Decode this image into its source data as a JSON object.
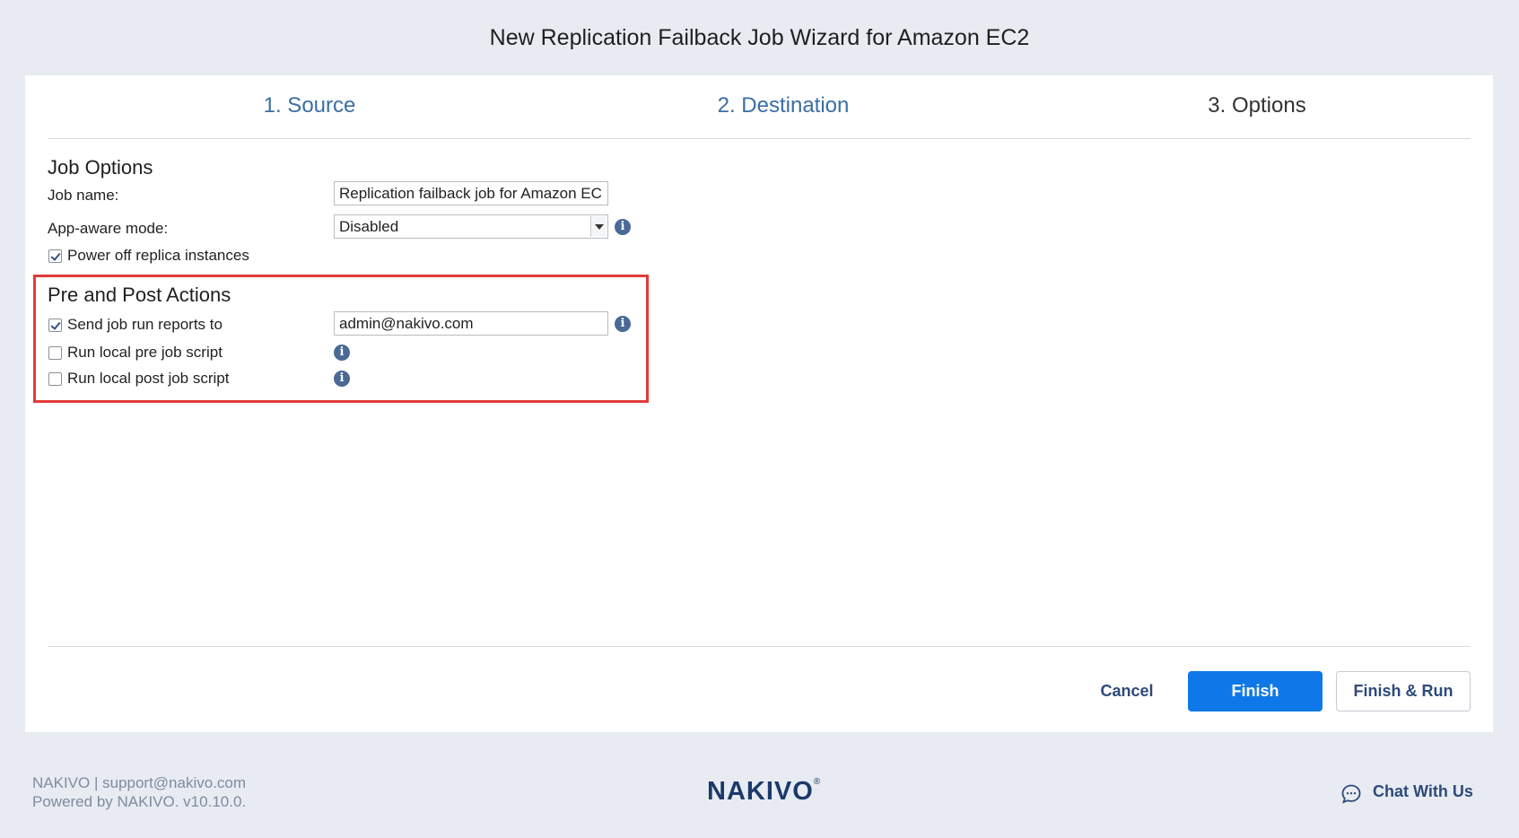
{
  "window": {
    "title": "New Replication Failback Job Wizard for Amazon EC2"
  },
  "steps": [
    {
      "label": "1. Source",
      "state": "done"
    },
    {
      "label": "2. Destination",
      "state": "done"
    },
    {
      "label": "3. Options",
      "state": "active"
    }
  ],
  "job_options": {
    "title": "Job Options",
    "job_name_label": "Job name:",
    "job_name_value": "Replication failback job for Amazon EC",
    "app_aware_label": "App-aware mode:",
    "app_aware_value": "Disabled",
    "power_off_label": "Power off replica instances",
    "power_off_checked": true
  },
  "pre_post": {
    "title": "Pre and Post Actions",
    "send_reports_label": "Send job run reports to",
    "send_reports_checked": true,
    "send_reports_value": "admin@nakivo.com",
    "pre_script_label": "Run local pre job script",
    "pre_script_checked": false,
    "post_script_label": "Run local post job script",
    "post_script_checked": false
  },
  "buttons": {
    "cancel": "Cancel",
    "finish": "Finish",
    "finish_run": "Finish & Run"
  },
  "footer": {
    "support_line": "NAKIVO | support@nakivo.com",
    "version_line": "Powered by NAKIVO. v10.10.0.",
    "logo": "NAKIVO",
    "chat": "Chat With Us"
  },
  "colors": {
    "accent": "#0f78e8",
    "step_done": "#3a6ea5",
    "highlight": "#e23b3b",
    "background": "#e8ecf2"
  },
  "icons": {
    "info": "info-icon",
    "chat": "chat-bubble-icon",
    "dropdown": "chevron-down-icon"
  }
}
